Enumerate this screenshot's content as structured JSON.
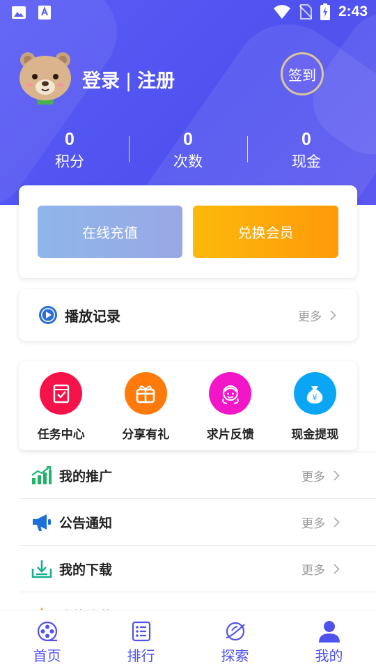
{
  "status_bar": {
    "time": "2:43"
  },
  "profile": {
    "login_label": "登录",
    "separator": "|",
    "register_label": "注册",
    "signin_label": "签到"
  },
  "stats": [
    {
      "value": "0",
      "label": "积分"
    },
    {
      "value": "0",
      "label": "次数"
    },
    {
      "value": "0",
      "label": "现金"
    }
  ],
  "actions": {
    "recharge_label": "在线充值",
    "vip_label": "兑换会员"
  },
  "history": {
    "title": "播放记录",
    "more": "更多"
  },
  "grid": [
    {
      "label": "任务中心",
      "icon": "task-icon",
      "color": "#f5134a"
    },
    {
      "label": "分享有礼",
      "icon": "gift-icon",
      "color": "#ff7a0a"
    },
    {
      "label": "求片反馈",
      "icon": "support-agent-icon",
      "color": "#f315c8"
    },
    {
      "label": "现金提现",
      "icon": "money-bag-icon",
      "color": "#0aa6f5"
    }
  ],
  "list": [
    {
      "title": "我的推广",
      "icon": "chart-icon",
      "more": "更多"
    },
    {
      "title": "公告通知",
      "icon": "megaphone-icon",
      "more": "更多"
    },
    {
      "title": "我的下载",
      "icon": "download-icon",
      "more": "更多"
    },
    {
      "title": "我的收藏",
      "icon": "favorite-icon",
      "more": "更多"
    }
  ],
  "nav": [
    {
      "label": "首页",
      "icon": "film-reel-icon"
    },
    {
      "label": "排行",
      "icon": "ranking-list-icon"
    },
    {
      "label": "探索",
      "icon": "planet-icon"
    },
    {
      "label": "我的",
      "icon": "person-icon"
    }
  ],
  "colors": {
    "primary": "#4f52ef",
    "recharge": "#8fb6ea",
    "vip": "#fea60a"
  }
}
